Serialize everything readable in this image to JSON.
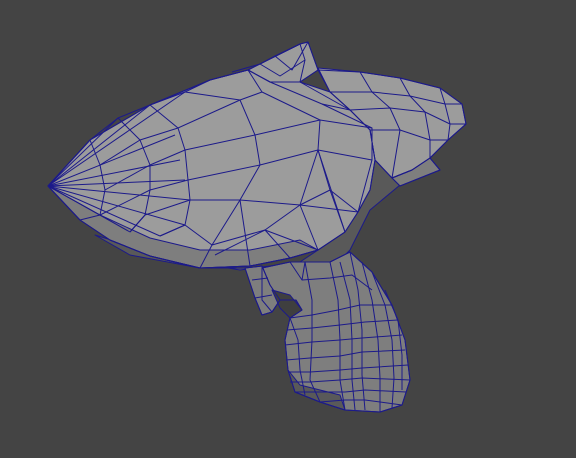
{
  "viewport": {
    "background_color": "#444444",
    "wire_color": "#1c1a8a",
    "shade_light": "#9c9c9c",
    "shade_mid": "#7e7e7e",
    "shade_dark": "#595959",
    "shade_deep": "#3f3f3f"
  },
  "model": {
    "object": "raygun-mesh",
    "display_mode": "wireframe-on-shaded"
  }
}
